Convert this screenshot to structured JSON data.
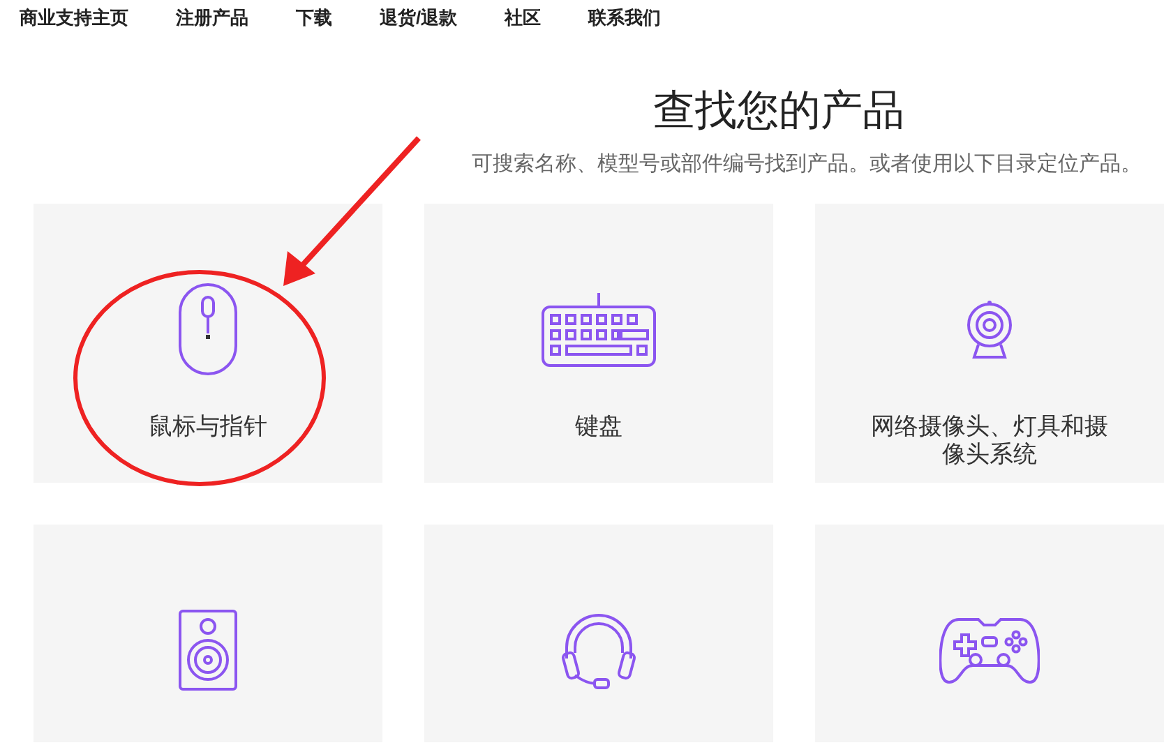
{
  "nav": {
    "items": [
      "商业支持主页",
      "注册产品",
      "下载",
      "退货/退款",
      "社区",
      "联系我们"
    ]
  },
  "header": {
    "title": "查找您的产品",
    "subtitle": "可搜索名称、模型号或部件编号找到产品。或者使用以下目录定位产品。"
  },
  "categories": [
    {
      "kind": "mouse",
      "label": "鼠标与指针"
    },
    {
      "kind": "keyboard",
      "label": "键盘"
    },
    {
      "kind": "webcam",
      "label": "网络摄像头、灯具和摄像头系统"
    },
    {
      "kind": "speaker"
    },
    {
      "kind": "headset"
    },
    {
      "kind": "gamepad"
    }
  ],
  "annotations": [
    {
      "kind": "ellipse"
    },
    {
      "kind": "arrow"
    }
  ]
}
